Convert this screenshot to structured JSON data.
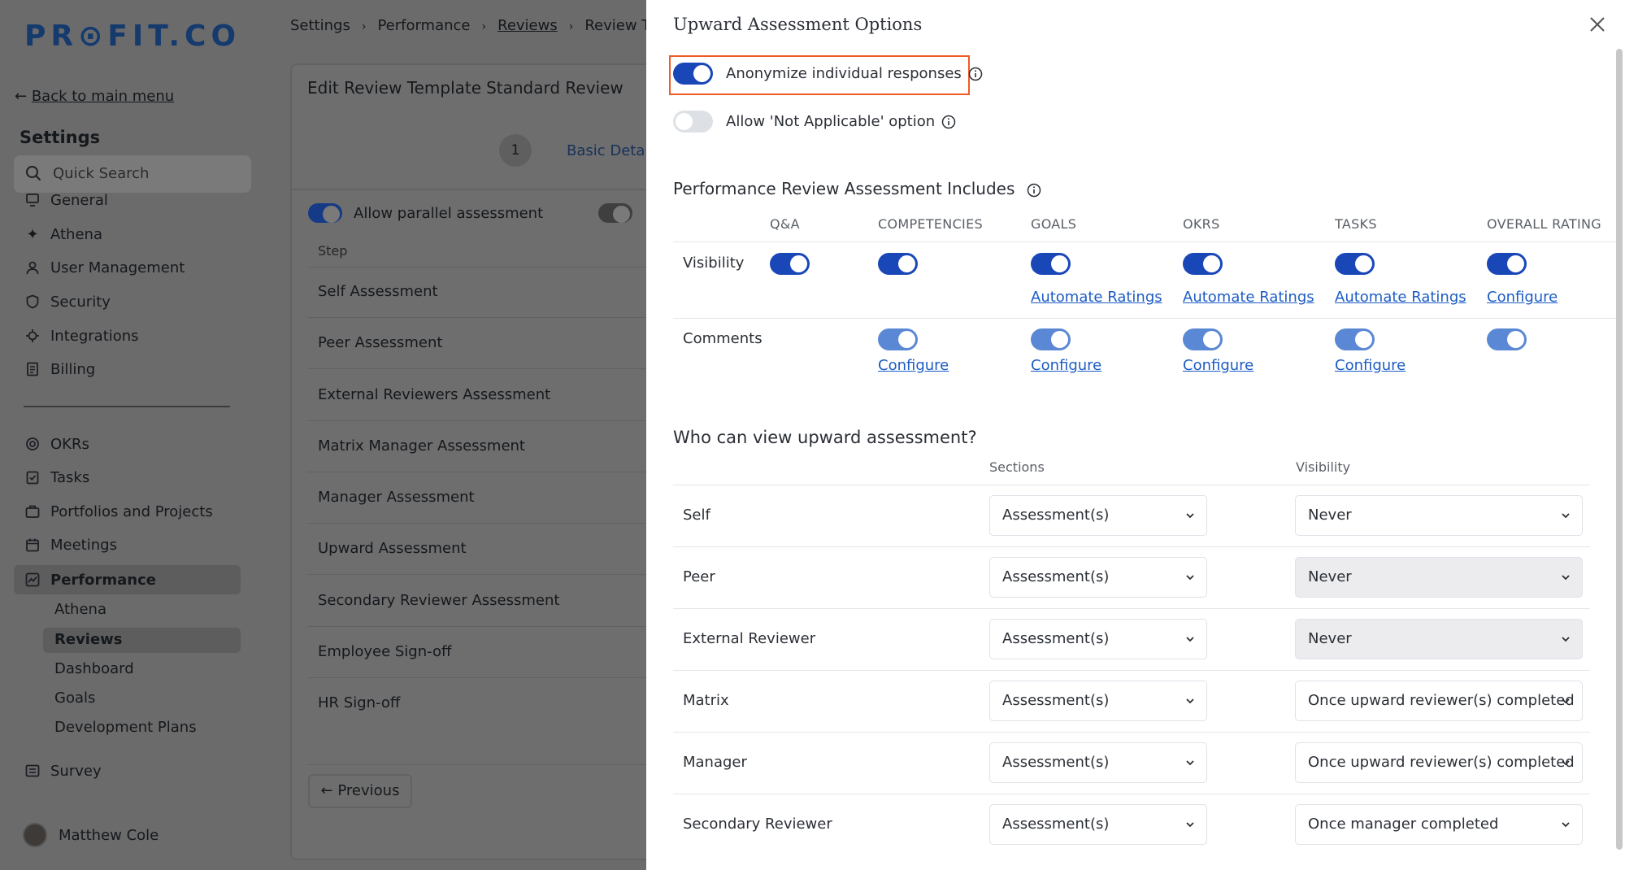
{
  "sidebar": {
    "logo": "PR⊙FIT.CO",
    "back_label": "Back to main menu",
    "settings_title": "Settings",
    "search_placeholder": "Quick Search",
    "settings_items": [
      "General",
      "Athena",
      "User Management",
      "Security",
      "Integrations",
      "Billing"
    ],
    "modules": [
      "OKRs",
      "Tasks",
      "Portfolios and Projects",
      "Meetings",
      "Performance"
    ],
    "performance_sub": [
      "Athena",
      "Reviews",
      "Dashboard",
      "Goals",
      "Development Plans"
    ],
    "survey": "Survey",
    "user_name": "Matthew Cole"
  },
  "breadcrumb": [
    "Settings",
    "Performance",
    "Reviews",
    "Review Ter"
  ],
  "main": {
    "title": "Edit Review Template",
    "template_name": "Standard Review",
    "step_number": "1",
    "step_label": "Basic Details",
    "parallel_label": "Allow parallel assessment",
    "step_header": "Step",
    "steps": [
      "Self Assessment",
      "Peer Assessment",
      "External Reviewers Assessment",
      "Matrix Manager Assessment",
      "Manager Assessment",
      "Upward Assessment",
      "Secondary Reviewer Assessment",
      "Employee Sign-off",
      "HR Sign-off"
    ],
    "previous_label": "Previous"
  },
  "panel": {
    "title": "Upward Assessment Options",
    "anonymize_label": "Anonymize individual responses",
    "anonymize_on": true,
    "not_applicable_label": "Allow 'Not Applicable' option",
    "not_applicable_on": false,
    "includes_title": "Performance Review Assessment Includes",
    "columns": [
      "Q&A",
      "COMPETENCIES",
      "GOALS",
      "OKRS",
      "TASKS",
      "OVERALL RATING"
    ],
    "visibility_label": "Visibility",
    "comments_label": "Comments",
    "automate_label": "Automate Ratings",
    "configure_label": "Configure",
    "who_title": "Who can view upward assessment?",
    "sections_header": "Sections",
    "visibility_header": "Visibility",
    "viewers": [
      {
        "role": "Self",
        "section": "Assessment(s)",
        "visibility": "Never"
      },
      {
        "role": "Peer",
        "section": "Assessment(s)",
        "visibility": "Never"
      },
      {
        "role": "External Reviewer",
        "section": "Assessment(s)",
        "visibility": "Never"
      },
      {
        "role": "Matrix",
        "section": "Assessment(s)",
        "visibility": "Once upward reviewer(s) completed"
      },
      {
        "role": "Manager",
        "section": "Assessment(s)",
        "visibility": "Once upward reviewer(s) completed"
      },
      {
        "role": "Secondary Reviewer",
        "section": "Assessment(s)",
        "visibility": "Once manager completed"
      }
    ]
  },
  "colors": {
    "toggle_on": "#1947b8",
    "toggle_semi": "#5b88d4",
    "link": "#1c5cc4",
    "highlight": "#f05a24",
    "overlay": "#6b6b6b"
  }
}
